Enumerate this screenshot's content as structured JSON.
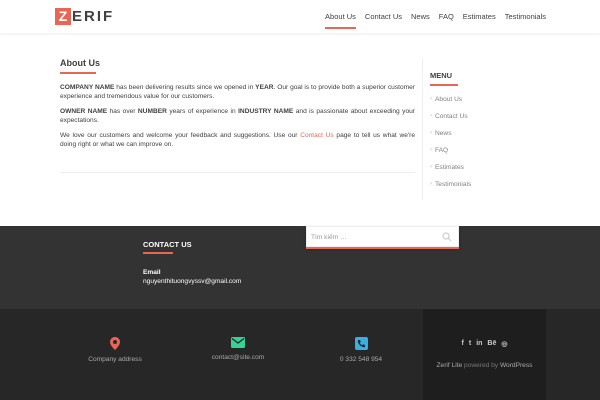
{
  "header": {
    "logo_first": "Z",
    "logo_rest": "ERIF",
    "nav": [
      {
        "label": "About Us"
      },
      {
        "label": "Contact Us"
      },
      {
        "label": "News"
      },
      {
        "label": "FAQ"
      },
      {
        "label": "Estimates"
      },
      {
        "label": "Testimonials"
      }
    ]
  },
  "main": {
    "title": "About Us",
    "p1": {
      "b1": "COMPANY NAME",
      "t1": " has been delivering results since we opened in ",
      "b2": "YEAR",
      "t2": ". Our goal is to provide both a superior customer experience and tremendous value for our customers."
    },
    "p2": {
      "b1": "OWNER NAME",
      "t1": " has over ",
      "b2": "NUMBER",
      "t2": " years of experience in ",
      "b3": "INDUSTRY NAME",
      "t3": " and is passionate about exceeding your expectations."
    },
    "p3": {
      "t1": "We love our customers and welcome your feedback and suggestions. Use our ",
      "link": "Contact Us",
      "t2": " page to tell us what we're doing right or what we can improve on."
    }
  },
  "sidebar": {
    "title": "MENU",
    "items": [
      {
        "label": "About Us"
      },
      {
        "label": "Contact Us"
      },
      {
        "label": "News"
      },
      {
        "label": "FAQ"
      },
      {
        "label": "Estimates"
      },
      {
        "label": "Testimonials"
      }
    ]
  },
  "footer": {
    "contact_title": "CONTACT US",
    "email_label": "Email",
    "email_value": "nguyenthituongvyssv@gmail.com",
    "search_placeholder": "Tìm kiếm …",
    "address": "Company address",
    "email": "contact@site.com",
    "phone": "0 332 548 954",
    "social": [
      "f",
      "t",
      "in",
      "Bē",
      "◎"
    ],
    "credit_theme": "Zerif Lite",
    "credit_mid": " powered by ",
    "credit_wp": "WordPress",
    "colors": {
      "accent": "#e96656",
      "address_icon": "#e96656",
      "email_icon": "#34d293",
      "phone_icon": "#3ab0e2"
    }
  }
}
